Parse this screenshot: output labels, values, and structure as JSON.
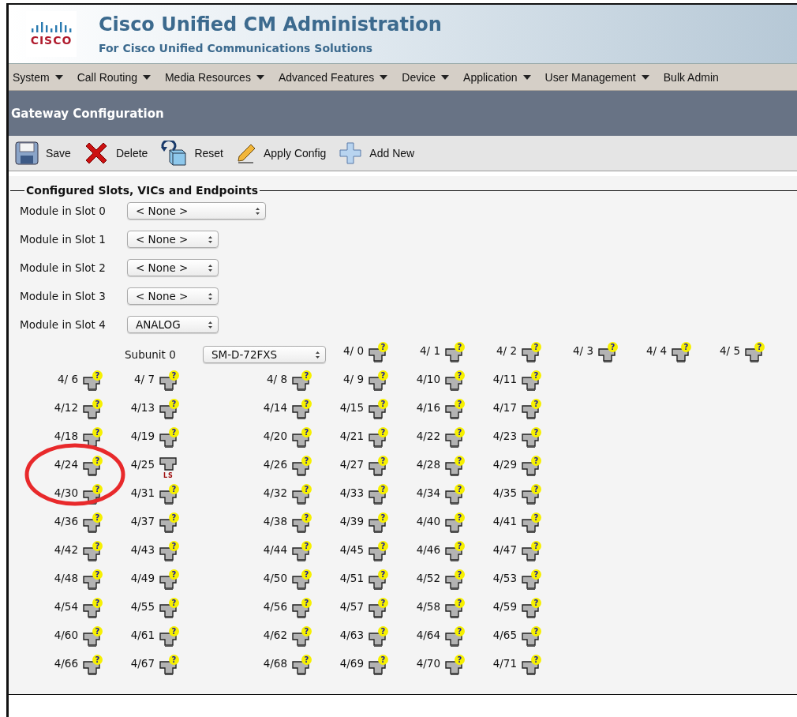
{
  "header": {
    "logo_text": "CISCO",
    "title": "Cisco Unified CM Administration",
    "subtitle": "For Cisco Unified Communications Solutions"
  },
  "menu": [
    "System",
    "Call Routing",
    "Media Resources",
    "Advanced Features",
    "Device",
    "Application",
    "User Management",
    "Bulk Admin"
  ],
  "page_title": "Gateway Configuration",
  "toolbar": [
    {
      "kind": "save",
      "label": "Save"
    },
    {
      "kind": "delete",
      "label": "Delete"
    },
    {
      "kind": "reset",
      "label": "Reset"
    },
    {
      "kind": "apply",
      "label": "Apply Config"
    },
    {
      "kind": "add",
      "label": "Add New"
    }
  ],
  "section": {
    "legend": "Configured Slots, VICs and Endpoints",
    "modules": [
      {
        "label": "Module in Slot 0",
        "value": "< None >",
        "wide": true
      },
      {
        "label": "Module in Slot 1",
        "value": "< None >",
        "wide": false
      },
      {
        "label": "Module in Slot 2",
        "value": "< None >",
        "wide": false
      },
      {
        "label": "Module in Slot 3",
        "value": "< None >",
        "wide": false
      },
      {
        "label": "Module in Slot 4",
        "value": "ANALOG",
        "wide": false
      }
    ],
    "subunit": {
      "label": "Subunit 0",
      "value": "SM-D-72FXS"
    },
    "port_rows": [
      [
        {
          "label": "4/ 0",
          "kind": "unknown",
          "status": "?"
        },
        {
          "label": "4/ 1",
          "kind": "unknown",
          "status": "?"
        },
        {
          "label": "4/ 2",
          "kind": "unknown",
          "status": "?"
        },
        {
          "label": "4/ 3",
          "kind": "unknown",
          "status": "?"
        },
        {
          "label": "4/ 4",
          "kind": "unknown",
          "status": "?"
        },
        {
          "label": "4/ 5",
          "kind": "unknown",
          "status": "?"
        }
      ],
      [
        {
          "label": "4/ 6",
          "kind": "unknown",
          "status": "?"
        },
        {
          "label": "4/ 7",
          "kind": "unknown",
          "status": "?"
        },
        {
          "label": "4/ 8",
          "kind": "unknown",
          "status": "?"
        },
        {
          "label": "4/ 9",
          "kind": "unknown",
          "status": "?"
        },
        {
          "label": "4/10",
          "kind": "unknown",
          "status": "?"
        },
        {
          "label": "4/11",
          "kind": "unknown",
          "status": "?"
        }
      ],
      [
        {
          "label": "4/12",
          "kind": "unknown",
          "status": "?"
        },
        {
          "label": "4/13",
          "kind": "unknown",
          "status": "?"
        },
        {
          "label": "4/14",
          "kind": "unknown",
          "status": "?"
        },
        {
          "label": "4/15",
          "kind": "unknown",
          "status": "?"
        },
        {
          "label": "4/16",
          "kind": "unknown",
          "status": "?"
        },
        {
          "label": "4/17",
          "kind": "unknown",
          "status": "?"
        }
      ],
      [
        {
          "label": "4/18",
          "kind": "unknown",
          "status": "?"
        },
        {
          "label": "4/19",
          "kind": "unknown",
          "status": "?"
        },
        {
          "label": "4/20",
          "kind": "unknown",
          "status": "?"
        },
        {
          "label": "4/21",
          "kind": "unknown",
          "status": "?"
        },
        {
          "label": "4/22",
          "kind": "unknown",
          "status": "?"
        },
        {
          "label": "4/23",
          "kind": "unknown",
          "status": "?"
        }
      ],
      [
        {
          "label": "4/24",
          "kind": "unknown",
          "status": "?"
        },
        {
          "label": "4/25",
          "kind": "configured",
          "status": "LS"
        },
        {
          "label": "4/26",
          "kind": "unknown",
          "status": "?"
        },
        {
          "label": "4/27",
          "kind": "unknown",
          "status": "?"
        },
        {
          "label": "4/28",
          "kind": "unknown",
          "status": "?"
        },
        {
          "label": "4/29",
          "kind": "unknown",
          "status": "?"
        }
      ],
      [
        {
          "label": "4/30",
          "kind": "unknown",
          "status": "?"
        },
        {
          "label": "4/31",
          "kind": "unknown",
          "status": "?"
        },
        {
          "label": "4/32",
          "kind": "unknown",
          "status": "?"
        },
        {
          "label": "4/33",
          "kind": "unknown",
          "status": "?"
        },
        {
          "label": "4/34",
          "kind": "unknown",
          "status": "?"
        },
        {
          "label": "4/35",
          "kind": "unknown",
          "status": "?"
        }
      ],
      [
        {
          "label": "4/36",
          "kind": "unknown",
          "status": "?"
        },
        {
          "label": "4/37",
          "kind": "unknown",
          "status": "?"
        },
        {
          "label": "4/38",
          "kind": "unknown",
          "status": "?"
        },
        {
          "label": "4/39",
          "kind": "unknown",
          "status": "?"
        },
        {
          "label": "4/40",
          "kind": "unknown",
          "status": "?"
        },
        {
          "label": "4/41",
          "kind": "unknown",
          "status": "?"
        }
      ],
      [
        {
          "label": "4/42",
          "kind": "unknown",
          "status": "?"
        },
        {
          "label": "4/43",
          "kind": "unknown",
          "status": "?"
        },
        {
          "label": "4/44",
          "kind": "unknown",
          "status": "?"
        },
        {
          "label": "4/45",
          "kind": "unknown",
          "status": "?"
        },
        {
          "label": "4/46",
          "kind": "unknown",
          "status": "?"
        },
        {
          "label": "4/47",
          "kind": "unknown",
          "status": "?"
        }
      ],
      [
        {
          "label": "4/48",
          "kind": "unknown",
          "status": "?"
        },
        {
          "label": "4/49",
          "kind": "unknown",
          "status": "?"
        },
        {
          "label": "4/50",
          "kind": "unknown",
          "status": "?"
        },
        {
          "label": "4/51",
          "kind": "unknown",
          "status": "?"
        },
        {
          "label": "4/52",
          "kind": "unknown",
          "status": "?"
        },
        {
          "label": "4/53",
          "kind": "unknown",
          "status": "?"
        }
      ],
      [
        {
          "label": "4/54",
          "kind": "unknown",
          "status": "?"
        },
        {
          "label": "4/55",
          "kind": "unknown",
          "status": "?"
        },
        {
          "label": "4/56",
          "kind": "unknown",
          "status": "?"
        },
        {
          "label": "4/57",
          "kind": "unknown",
          "status": "?"
        },
        {
          "label": "4/58",
          "kind": "unknown",
          "status": "?"
        },
        {
          "label": "4/59",
          "kind": "unknown",
          "status": "?"
        }
      ],
      [
        {
          "label": "4/60",
          "kind": "unknown",
          "status": "?"
        },
        {
          "label": "4/61",
          "kind": "unknown",
          "status": "?"
        },
        {
          "label": "4/62",
          "kind": "unknown",
          "status": "?"
        },
        {
          "label": "4/63",
          "kind": "unknown",
          "status": "?"
        },
        {
          "label": "4/64",
          "kind": "unknown",
          "status": "?"
        },
        {
          "label": "4/65",
          "kind": "unknown",
          "status": "?"
        }
      ],
      [
        {
          "label": "4/66",
          "kind": "unknown",
          "status": "?"
        },
        {
          "label": "4/67",
          "kind": "unknown",
          "status": "?"
        },
        {
          "label": "4/68",
          "kind": "unknown",
          "status": "?"
        },
        {
          "label": "4/69",
          "kind": "unknown",
          "status": "?"
        },
        {
          "label": "4/70",
          "kind": "unknown",
          "status": "?"
        },
        {
          "label": "4/71",
          "kind": "unknown",
          "status": "?"
        }
      ]
    ]
  }
}
